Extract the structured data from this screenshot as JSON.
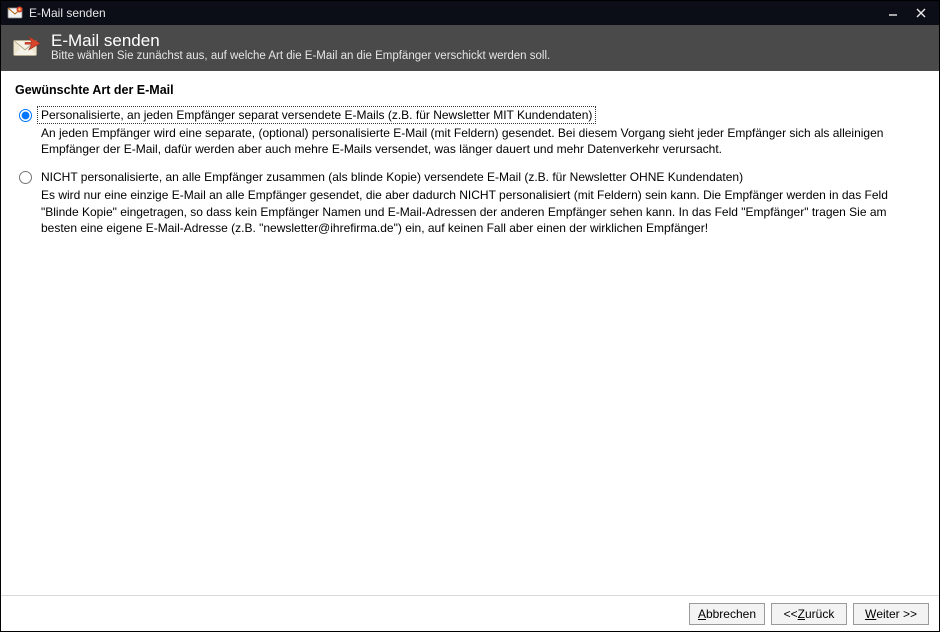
{
  "window": {
    "title": "E-Mail senden"
  },
  "header": {
    "title": "E-Mail senden",
    "subtitle": "Bitte wählen Sie zunächst aus, auf welche Art die E-Mail an die Empfänger verschickt werden soll."
  },
  "section": {
    "heading": "Gewünschte Art der E-Mail"
  },
  "options": [
    {
      "label": "Personalisierte, an jeden Empfänger separat versendete E-Mails (z.B. für Newsletter MIT Kundendaten)",
      "description": "An jeden Empfänger wird eine separate, (optional) personalisierte E-Mail (mit Feldern) gesendet. Bei diesem Vorgang sieht jeder Empfänger sich als alleinigen Empfänger der E-Mail, dafür werden aber auch mehre E-Mails versendet, was länger dauert und mehr Datenverkehr verursacht.",
      "selected": true
    },
    {
      "label": "NICHT personalisierte, an alle Empfänger zusammen (als blinde Kopie) versendete E-Mail (z.B. für Newsletter OHNE Kundendaten)",
      "description": "Es wird nur eine einzige E-Mail an alle Empfänger gesendet, die aber dadurch NICHT personalisiert (mit Feldern) sein kann. Die Empfänger werden in das Feld \"Blinde Kopie\" eingetragen, so dass kein Empfänger Namen und E-Mail-Adressen der anderen Empfänger sehen kann. In das Feld \"Empfänger\" tragen Sie am besten eine eigene E-Mail-Adresse (z.B. \"newsletter@ihrefirma.de\") ein, auf keinen Fall aber einen der wirklichen Empfänger!",
      "selected": false
    }
  ],
  "buttons": {
    "cancel": "Abbrechen",
    "back_prefix": "<<  ",
    "back": "Zurück",
    "next": "Weiter",
    "next_suffix": " >>"
  }
}
